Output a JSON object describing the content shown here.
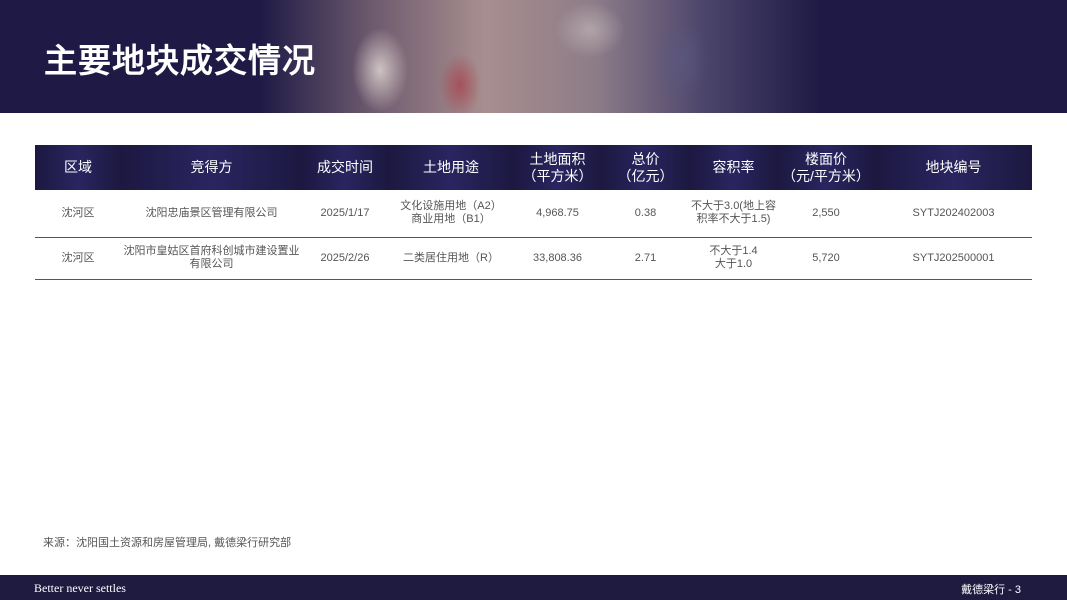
{
  "title": "主要地块成交情况",
  "table": {
    "headers": [
      "区域",
      "竞得方",
      "成交时间",
      "土地用途",
      "土地面积\n（平方米）",
      "总价\n（亿元）",
      "容积率",
      "楼面价\n（元/平方米）",
      "地块编号"
    ],
    "rows": [
      [
        "沈河区",
        "沈阳忠庙景区管理有限公司",
        "2025/1/17",
        "文化设施用地（A2）\n商业用地（B1）",
        "4,968.75",
        "0.38",
        "不大于3.0(地上容\n积率不大于1.5)",
        "2,550",
        "SYTJ202402003"
      ],
      [
        "沈河区",
        "沈阳市皇姑区首府科创城市建设置业\n有限公司",
        "2025/2/26",
        "二类居住用地（R）",
        "33,808.36",
        "2.71",
        "不大于1.4\n大于1.0",
        "5,720",
        "SYTJ202500001"
      ]
    ]
  },
  "source": "来源：沈阳国土资源和房屋管理局, 戴德梁行研究部",
  "footer": {
    "slogan": "Better never settles",
    "page": "戴德梁行 - 3"
  }
}
